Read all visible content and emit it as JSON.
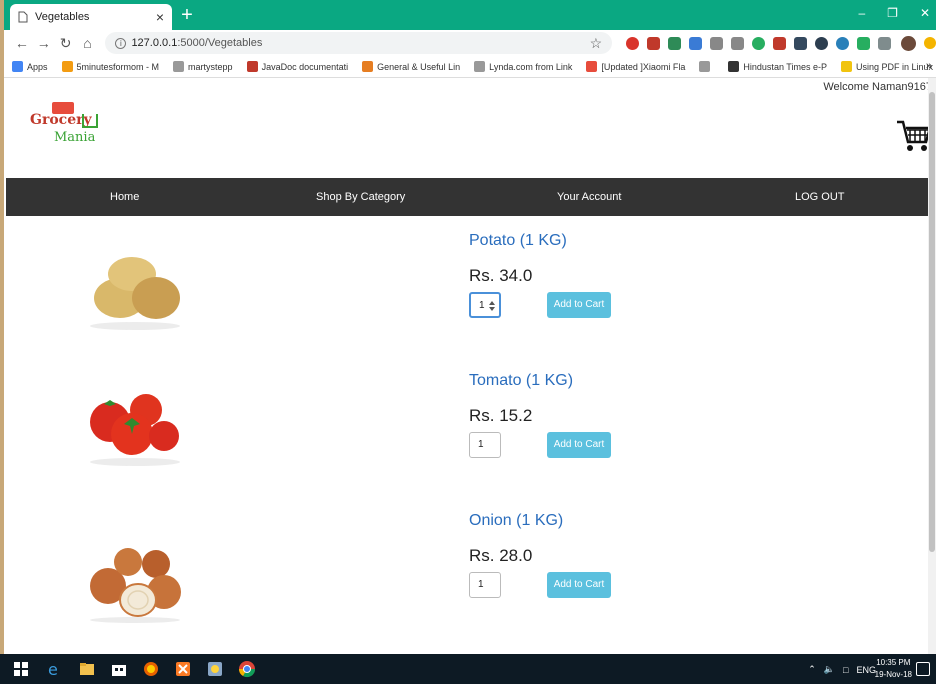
{
  "browser": {
    "tab_title": "Vegetables",
    "tab_close": "×",
    "new_tab": "+",
    "url_host": "127.0.0.1",
    "url_path": ":5000/Vegetables",
    "bookmarks": [
      {
        "label": "Apps",
        "color": "#4285f4"
      },
      {
        "label": "5minutesformom - M",
        "color": "#f39c12"
      },
      {
        "label": "martystepp",
        "color": "#999999"
      },
      {
        "label": "JavaDoc documentati",
        "color": "#c0392b"
      },
      {
        "label": "General & Useful Lin",
        "color": "#e67e22"
      },
      {
        "label": "Lynda.com from Link",
        "color": "#999999"
      },
      {
        "label": "[Updated ]Xiaomi Fla",
        "color": "#e74c3c"
      },
      {
        "label": "",
        "color": "#999999"
      },
      {
        "label": "Hindustan Times e-P",
        "color": "#333333"
      },
      {
        "label": "Using PDF in Linux",
        "color": "#f1c40f"
      }
    ],
    "bookmarks_more": "»"
  },
  "page": {
    "welcome": "Welcome Naman9167 ",
    "logo_line1": "Grocery",
    "logo_line2": "Mania",
    "menu": [
      "Home",
      "Shop By Category",
      "Your Account",
      "LOG OUT"
    ],
    "products": [
      {
        "name": "Potato (1 KG)",
        "price": "Rs. 34.0",
        "qty": "1",
        "button": "Add to Cart",
        "kind": "potato"
      },
      {
        "name": "Tomato (1 KG)",
        "price": "Rs. 15.2",
        "qty": "1",
        "button": "Add to Cart",
        "kind": "tomato"
      },
      {
        "name": "Onion (1 KG)",
        "price": "Rs. 28.0",
        "qty": "1",
        "button": "Add to Cart",
        "kind": "onion"
      }
    ]
  },
  "taskbar": {
    "lang": "ENG",
    "time": "10:35 PM",
    "date": "19-Nov-18"
  },
  "colors": {
    "titlebar": "#0aa882",
    "menu_bg": "#333333",
    "button": "#5bc0de",
    "product_name": "#2a6dbd"
  }
}
